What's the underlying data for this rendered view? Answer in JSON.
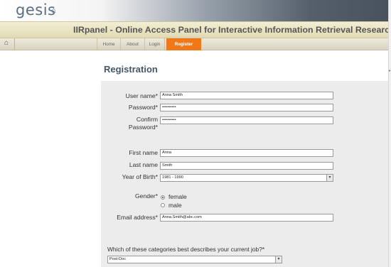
{
  "header": {
    "logo_text": "gesis",
    "logo_icon": "house-icon",
    "site_title": "IIRpanel - Online Access Panel for Interactive Information Retrieval Research"
  },
  "nav": {
    "home_icon": "house-icon",
    "items": [
      {
        "label": "Home"
      },
      {
        "label": "About"
      },
      {
        "label": "Login"
      },
      {
        "label": "Register",
        "active": true
      }
    ],
    "active_color": "#f07818"
  },
  "page": {
    "heading": "Registration"
  },
  "form": {
    "username": {
      "label": "User name*",
      "value": "Anna Smith"
    },
    "password": {
      "label": "Password*",
      "value": "••••••••••"
    },
    "confirm_password": {
      "label_line1": "Confirm",
      "label_line2": "Password*",
      "value": "••••••••••"
    },
    "first_name": {
      "label": "First name",
      "value": "Anna"
    },
    "last_name": {
      "label": "Last name",
      "value": "Smith"
    },
    "year_of_birth": {
      "label": "Year of Birth*",
      "selected": "1981 - 1990"
    },
    "gender": {
      "label": "Gender*",
      "options": [
        {
          "label": "female",
          "checked": true
        },
        {
          "label": "male",
          "checked": false
        }
      ]
    },
    "email": {
      "label": "Email address*",
      "value": "Anna.Smith@abc.com"
    },
    "job_question": {
      "label": "Which of these categories best describes your current job?*",
      "selected": "Post-Doc"
    }
  }
}
